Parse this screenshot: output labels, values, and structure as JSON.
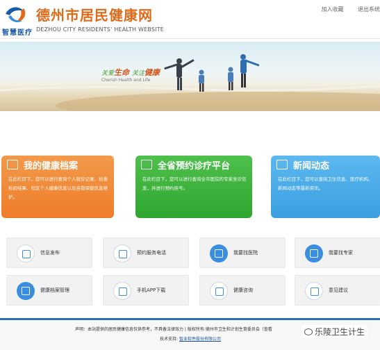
{
  "header": {
    "logo_text": "智慧医疗",
    "site_title": "德州市居民健康网",
    "site_subtitle": "DEZHOU CITY RESIDENTS' HEALTH WEBSITE",
    "links": [
      "加入收藏",
      "退出系统"
    ]
  },
  "banner": {
    "slogan_part1": "关爱",
    "slogan_word1": "生命",
    "slogan_part2": "关注",
    "slogan_word2": "健康",
    "slogan_en": "Cherish Health and Life"
  },
  "cards": [
    {
      "title": "我的健康档案",
      "desc": "在此栏目下，您可以进行查询个人就诊记录、检查检验结果、社区个人健康信息以及自我保健信息维护。",
      "color": "#ee7d2a"
    },
    {
      "title": "全省预约诊疗平台",
      "desc": "在此栏目下，您可以进行查询全市医院的专家坐诊信息，并进行预约挂号。",
      "color": "#2fa62f"
    },
    {
      "title": "新闻动态",
      "desc": "在此栏目下，您可以查阅卫生信息、医疗机构、新闻动态等最新资讯。",
      "color": "#3a9fe0"
    }
  ],
  "services": [
    {
      "label": "信息发布",
      "icon": "document-icon"
    },
    {
      "label": "预约服务电话",
      "icon": "phone-icon"
    },
    {
      "label": "我要找医院",
      "icon": "hospital-icon"
    },
    {
      "label": "我要找专家",
      "icon": "doctor-icon"
    },
    {
      "label": "健康档案管理",
      "icon": "profile-icon"
    },
    {
      "label": "手机APP下载",
      "icon": "mobile-icon"
    },
    {
      "label": "健康咨询",
      "icon": "mail-icon"
    },
    {
      "label": "意见建议",
      "icon": "layers-icon"
    }
  ],
  "footer": {
    "line1": "声明：本站提供的居民健康信息仅供参考，不具备法律效力 | 版权所有:德州市卫生和计划生育委员会（查看",
    "support_label": "技术支持:",
    "support_company": "智业软件股份有限公司"
  },
  "watermark": "乐陵卫生计生",
  "colors": {
    "primary": "#2a6fb5",
    "title_orange": "#e06a1a"
  }
}
